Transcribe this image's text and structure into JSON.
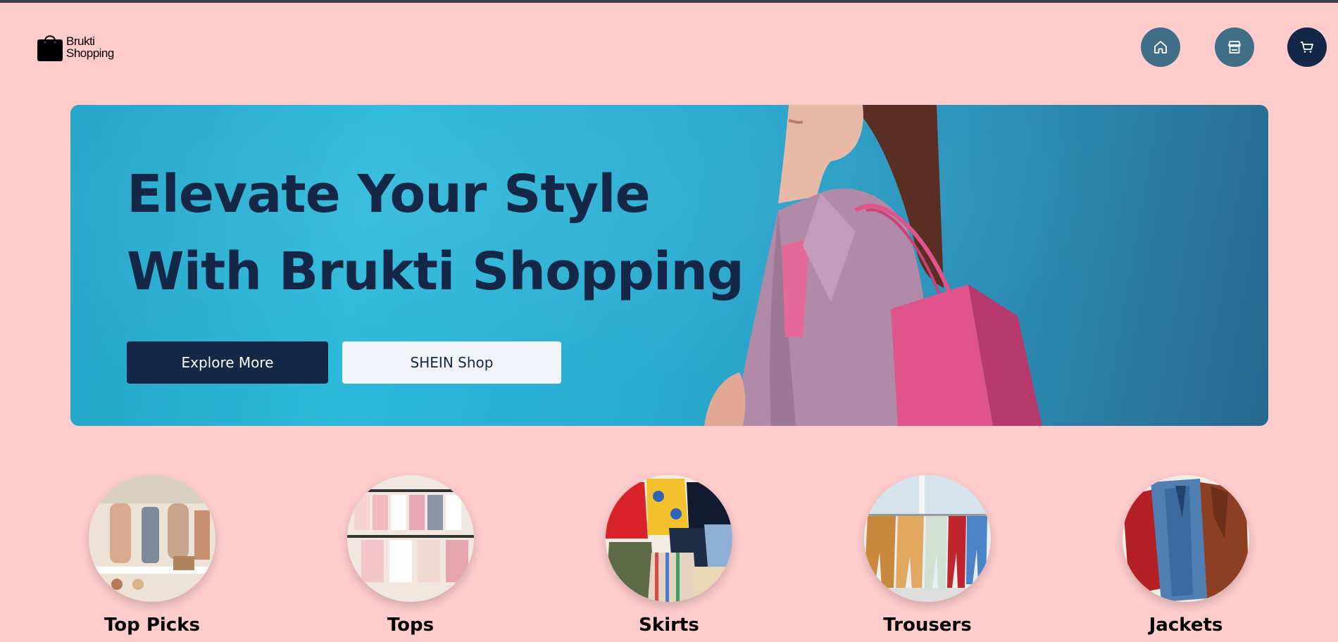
{
  "brand": {
    "name_line1": "Brukti",
    "name_line2": "Shopping"
  },
  "nav": {
    "items": [
      {
        "icon": "home-icon",
        "label": "Home"
      },
      {
        "icon": "store-icon",
        "label": "Shop"
      },
      {
        "icon": "cart-icon",
        "label": "Cart"
      }
    ]
  },
  "hero": {
    "title_line1": "Elevate Your Style",
    "title_line2": "With Brukti Shopping",
    "primary_button": "Explore More",
    "secondary_button": "SHEIN Shop"
  },
  "categories": [
    {
      "label": "Top Picks"
    },
    {
      "label": "Tops"
    },
    {
      "label": "Skirts"
    },
    {
      "label": "Trousers"
    },
    {
      "label": "Jackets"
    }
  ],
  "colors": {
    "background": "#ffcccc",
    "primary": "#152746",
    "nav_button": "#3f6f86",
    "hero_blue": "#2bb9da",
    "bag_pink": "#e0548c"
  }
}
